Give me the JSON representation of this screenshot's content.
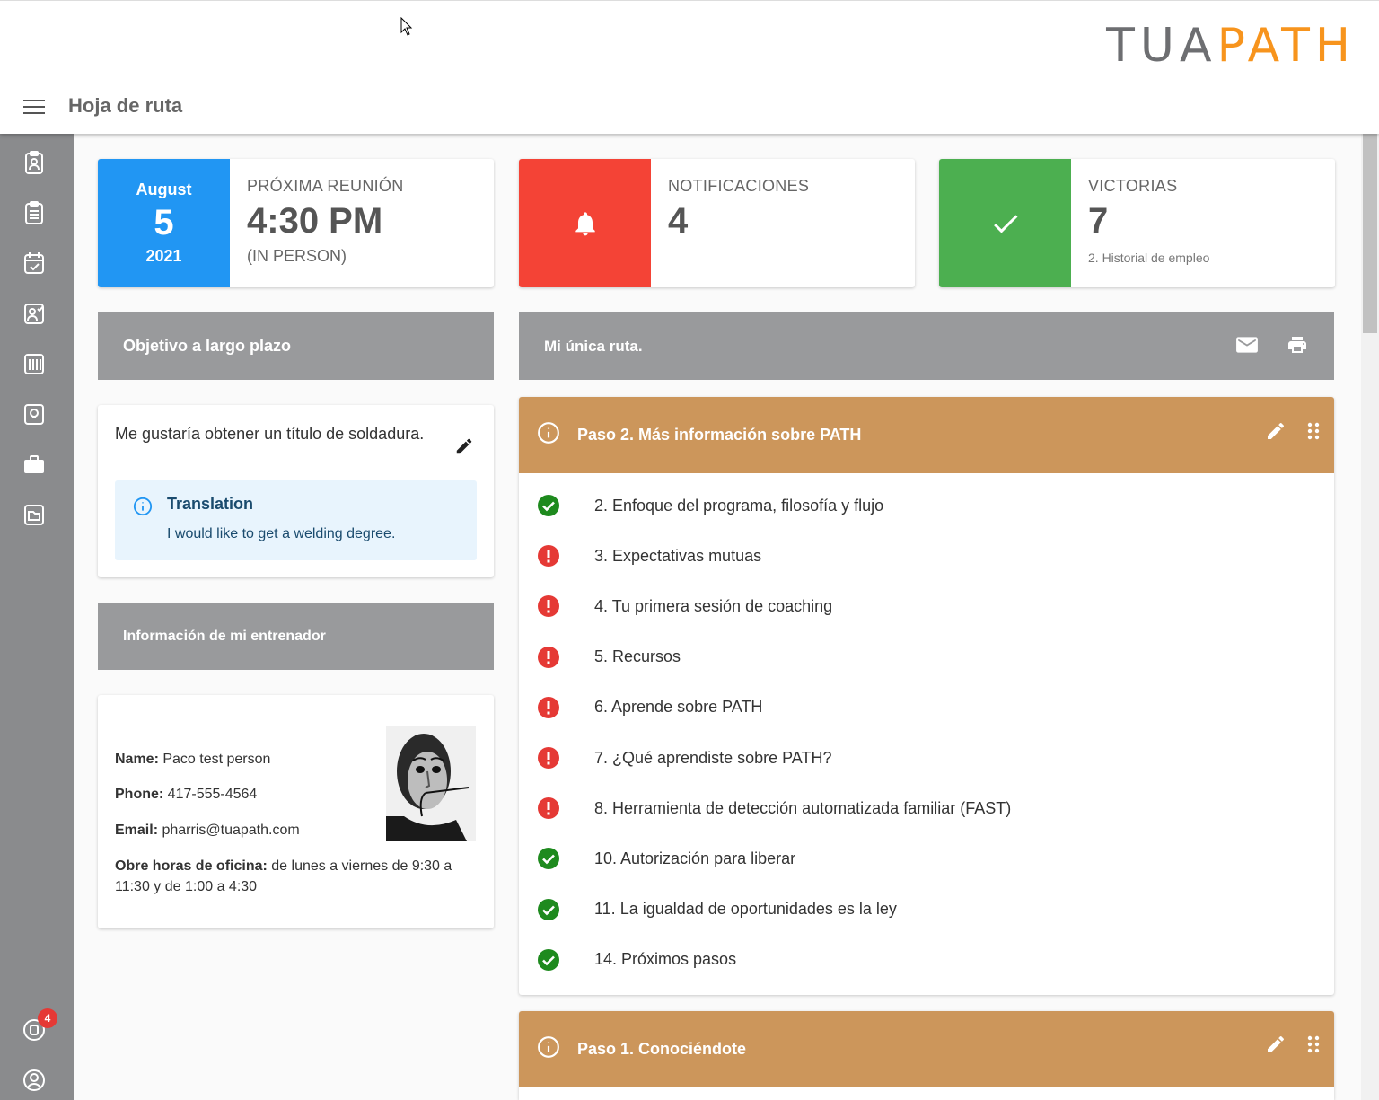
{
  "header": {
    "logo_part1": "TUA",
    "logo_part2": "PATH",
    "page_title": "Hoja de ruta"
  },
  "sidebar": {
    "items": [
      {
        "icon": "badge-clipboard-icon"
      },
      {
        "icon": "clipboard-list-icon"
      },
      {
        "icon": "calendar-check-icon"
      },
      {
        "icon": "person-check-icon"
      },
      {
        "icon": "book-icon"
      },
      {
        "icon": "lightbulb-icon"
      },
      {
        "icon": "briefcase-icon"
      },
      {
        "icon": "folder-icon"
      }
    ],
    "notifications_badge": "4",
    "notifications_icon": "notification-icon",
    "account_icon": "account-circle-icon"
  },
  "stats": {
    "meeting": {
      "month": "August",
      "day": "5",
      "year": "2021",
      "label": "PRÓXIMA REUNIÓN",
      "time": "4:30 PM",
      "mode": "(IN PERSON)",
      "color": "#2196f3"
    },
    "notifications": {
      "label": "NOTIFICACIONES",
      "value": "4",
      "icon": "bell-icon",
      "color": "#f44336"
    },
    "victories": {
      "label": "VICTORIAS",
      "value": "7",
      "sub": "2. Historial de empleo",
      "icon": "check-icon",
      "color": "#4caf50"
    }
  },
  "goal": {
    "header": "Objetivo a largo plazo",
    "text": "Me gustaría obtener un título de soldadura.",
    "translation_title": "Translation",
    "translation_text": "I would like to get a welding degree."
  },
  "coach": {
    "header": "Información de mi entrenador",
    "name_label": "Name:",
    "name": "Paco test person",
    "phone_label": "Phone:",
    "phone": "417-555-4564",
    "email_label": "Email:",
    "email": "pharris@tuapath.com",
    "hours_label": "Obre horas de oficina:",
    "hours": "de lunes a viernes de 9:30 a 11:30 y de 1:00 a 4:30"
  },
  "route": {
    "header": "Mi única ruta.",
    "steps": [
      {
        "title": "Paso 2. Más información sobre PATH",
        "items": [
          {
            "label": "2. Enfoque del programa, filosofía y flujo",
            "status": "done"
          },
          {
            "label": "3. Expectativas mutuas",
            "status": "pending"
          },
          {
            "label": "4. Tu primera sesión de coaching",
            "status": "pending"
          },
          {
            "label": "5. Recursos",
            "status": "pending"
          },
          {
            "label": "6. Aprende sobre PATH",
            "status": "pending"
          },
          {
            "label": "7. ¿Qué aprendiste sobre PATH?",
            "status": "pending"
          },
          {
            "label": "8. Herramienta de detección automatizada familiar (FAST)",
            "status": "pending"
          },
          {
            "label": "10. Autorización para liberar",
            "status": "done"
          },
          {
            "label": "11. La igualdad de oportunidades es la ley",
            "status": "done"
          },
          {
            "label": "14. Próximos pasos",
            "status": "done"
          }
        ]
      },
      {
        "title": "Paso 1. Conociéndote",
        "items": []
      }
    ],
    "step_color": "#cc965b",
    "done_color": "#1e8a1e",
    "pending_color": "#e53935"
  }
}
